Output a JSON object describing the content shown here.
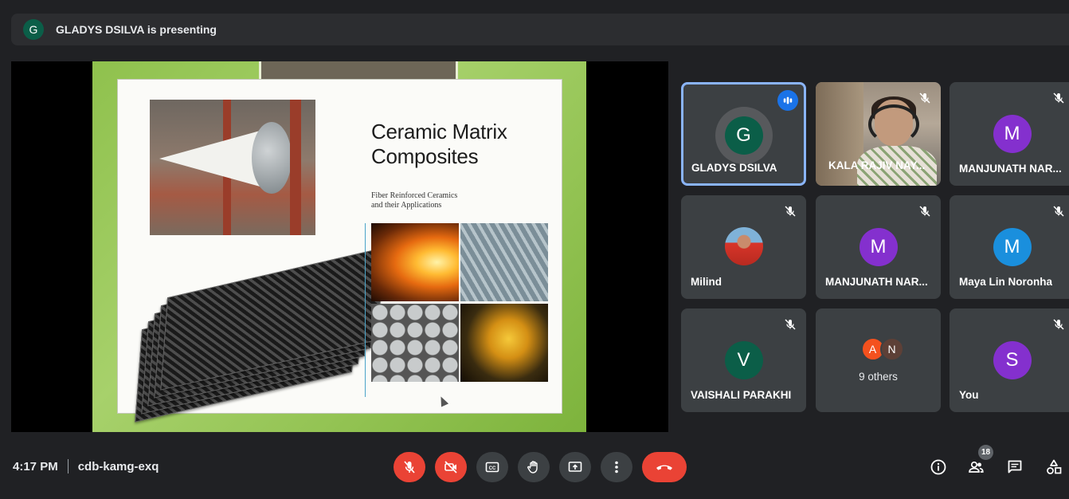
{
  "presenting": {
    "avatar_letter": "G",
    "text": "GLADYS DSILVA is presenting"
  },
  "slide": {
    "title_line1": "Ceramic Matrix",
    "title_line2": "Composites",
    "subtitle_line1": "Fiber Reinforced Ceramics",
    "subtitle_line2": "and their Applications"
  },
  "participants": [
    {
      "name": "GLADYS DSILVA",
      "avatar": "G",
      "color": "#0b5e48",
      "speaking": true
    },
    {
      "name": "KALA RAJIV NAY...",
      "video": true,
      "muted": true
    },
    {
      "name": "MANJUNATH NAR...",
      "avatar": "M",
      "color": "#8430ce",
      "muted": true
    },
    {
      "name": "Milind",
      "photo": true,
      "muted": true
    },
    {
      "name": "MANJUNATH NAR...",
      "avatar": "M",
      "color": "#8430ce",
      "muted": true
    },
    {
      "name": "Maya Lin Noronha",
      "avatar": "M",
      "color": "#1a8fdd",
      "muted": true
    },
    {
      "name": "VAISHALI PARAKHI",
      "avatar": "V",
      "color": "#0b5e48",
      "muted": true
    },
    {
      "name": "9 others",
      "mini_avatars": [
        "A",
        "N"
      ],
      "mini_colors": [
        "#f4511e",
        "#5d4037"
      ]
    },
    {
      "name": "You",
      "avatar": "S",
      "color": "#8430ce",
      "muted": true
    }
  ],
  "bottom": {
    "time": "4:17 PM",
    "meeting_code": "cdb-kamg-exq",
    "participant_count": "18"
  },
  "colors": {
    "end_call": "#ea4335",
    "control_bg": "#3c4043",
    "active_border": "#8ab4f8"
  }
}
